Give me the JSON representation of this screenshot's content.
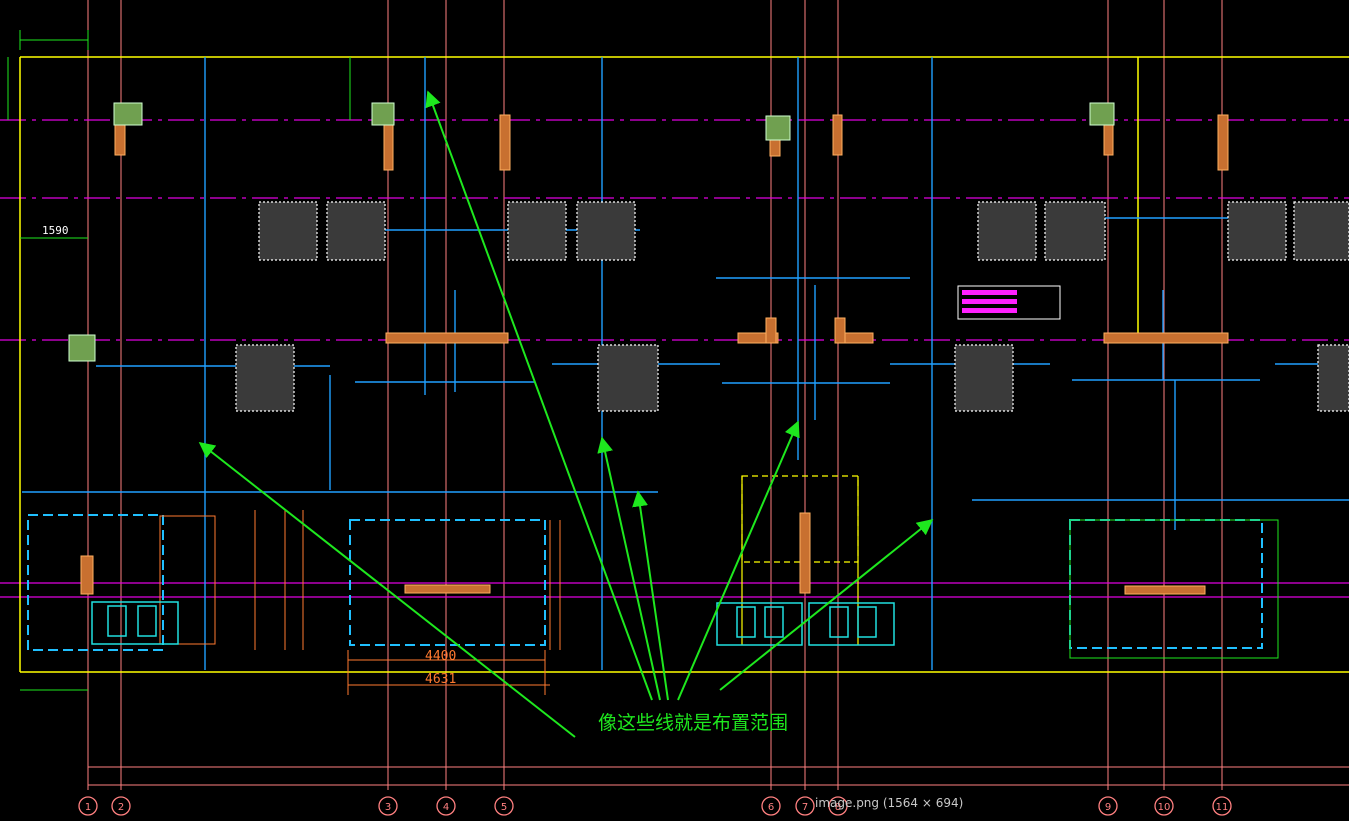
{
  "annotation": "像这些线就是布置范围",
  "status_caption": "image.png (1564 × 694)",
  "dimensions": {
    "d1590": "1590",
    "d4400": "4400",
    "d4631": "4631"
  },
  "axis_labels": [
    "1",
    "2",
    "3",
    "4",
    "5",
    "6",
    "7",
    "8",
    "9",
    "10",
    "11"
  ],
  "colors": {
    "background": "#000000",
    "boundary": "#ffff00",
    "grid_axis": "#ff8080",
    "axis_dash": "#e000e0",
    "range_line": "#20a0ff",
    "column": "#e07830",
    "annotation": "#1ee81e",
    "dimension": "#ff7a30",
    "equipment": "#ffffff"
  },
  "icons": {
    "axis_bubble": "circle-label",
    "pointer": "arrow"
  }
}
